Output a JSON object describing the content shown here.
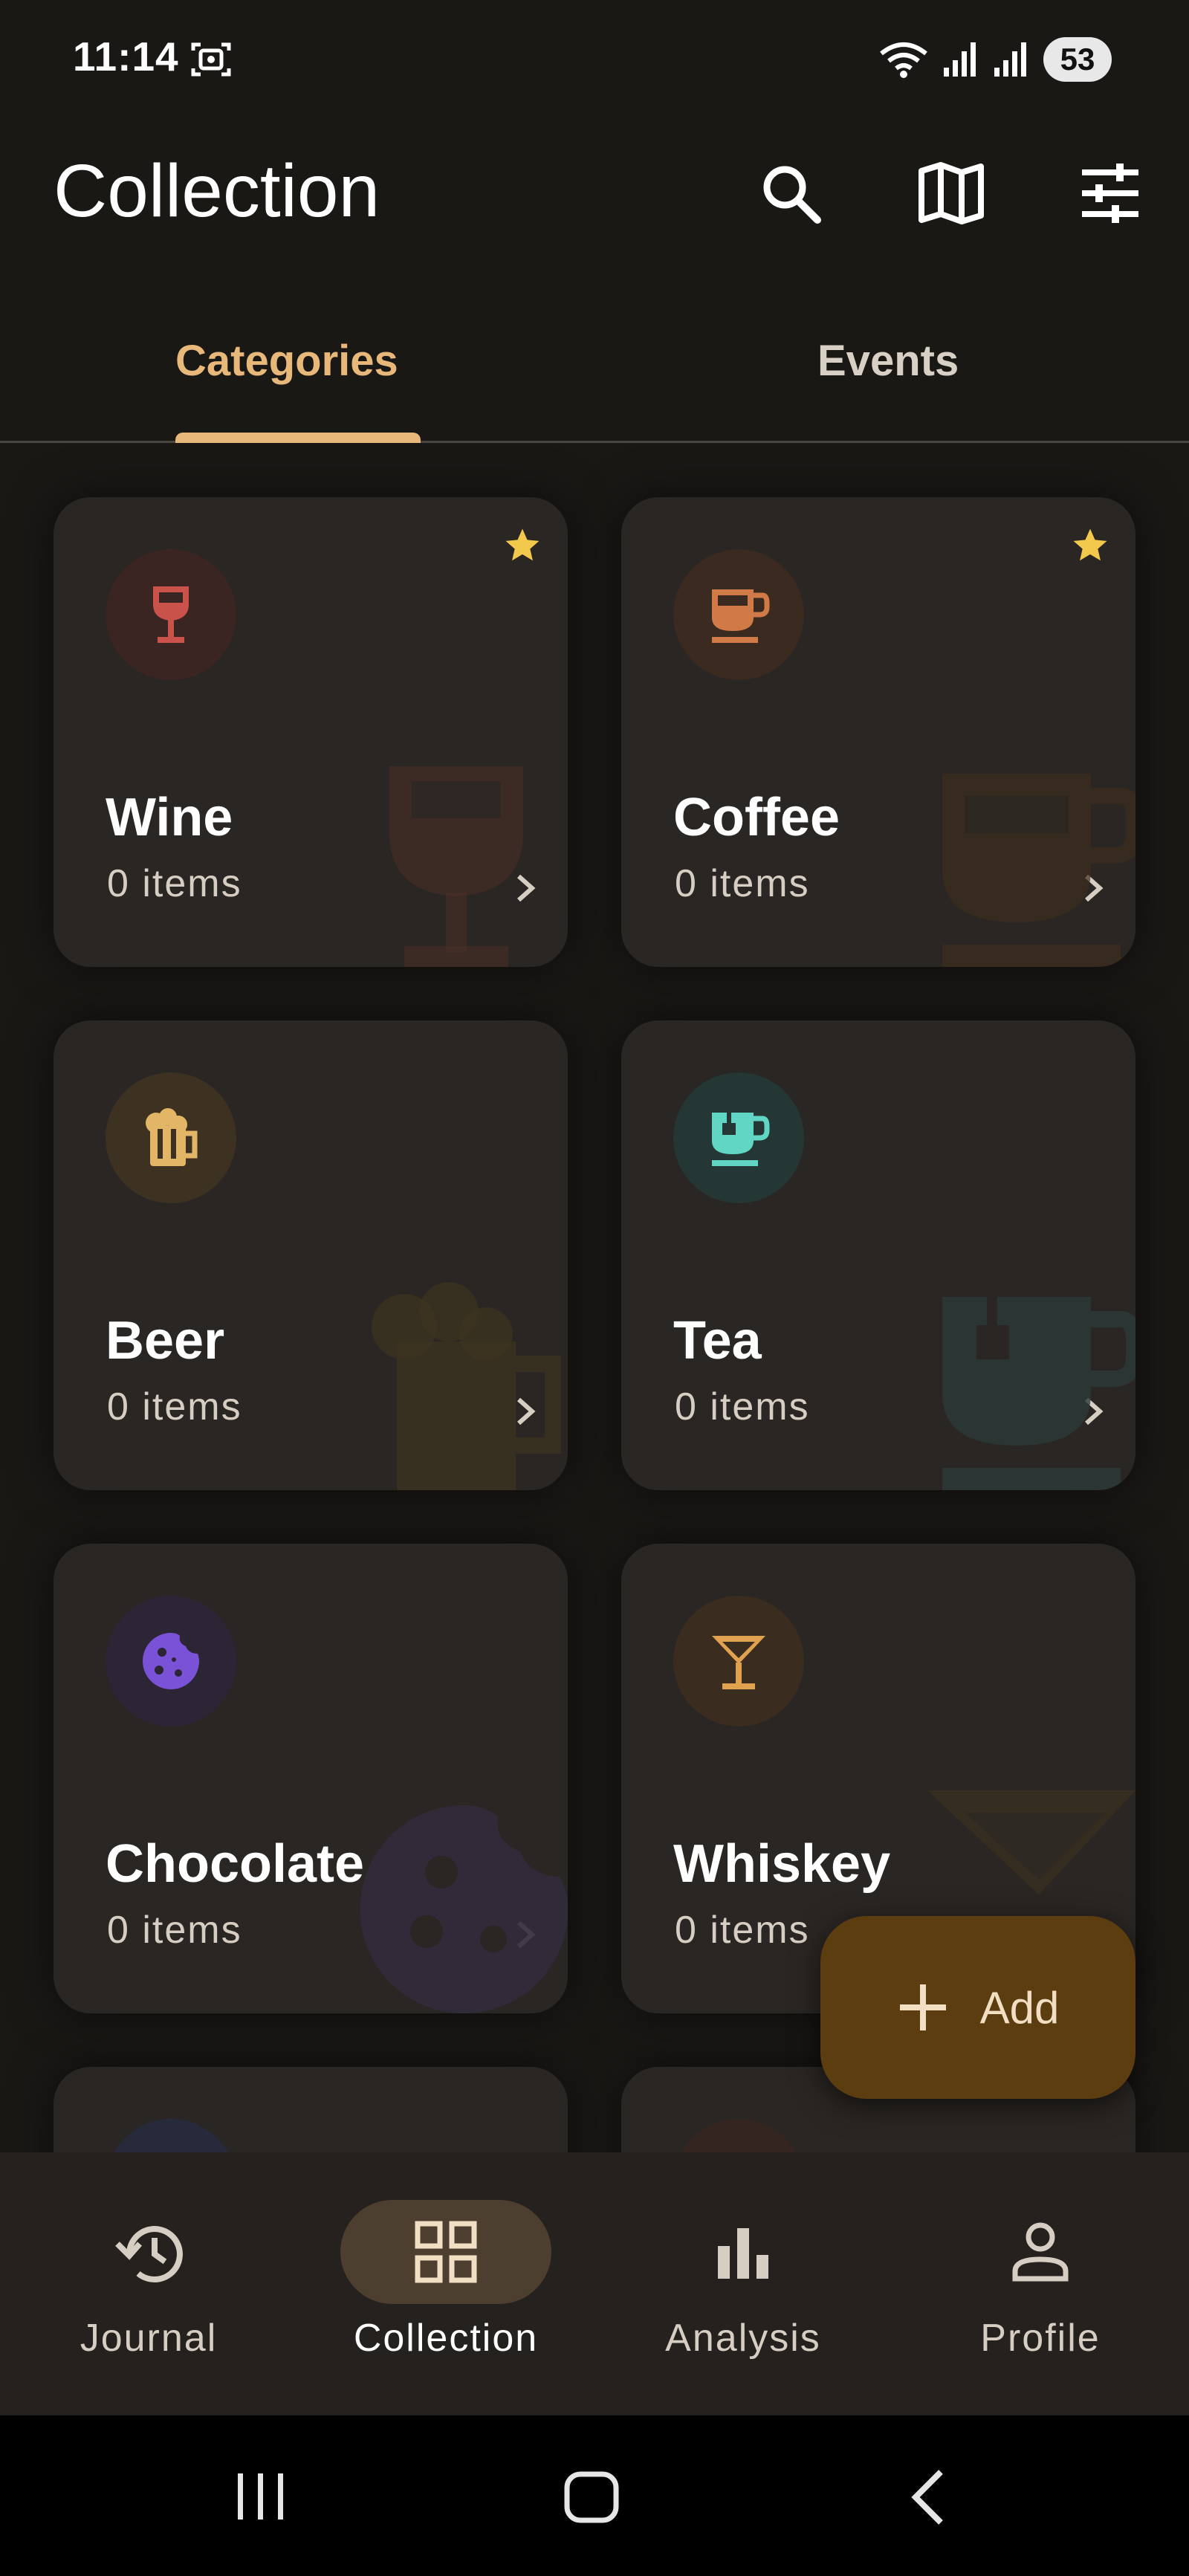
{
  "status_bar": {
    "time": "11:14",
    "battery": "53"
  },
  "header": {
    "title": "Collection"
  },
  "tabs": [
    {
      "label": "Categories",
      "active": true
    },
    {
      "label": "Events",
      "active": false
    }
  ],
  "categories": [
    {
      "name": "Wine",
      "count": "0 items",
      "favorite": true,
      "icon": "wine-glass-icon",
      "color": "#c9524a"
    },
    {
      "name": "Coffee",
      "count": "0 items",
      "favorite": true,
      "icon": "coffee-cup-icon",
      "color": "#d07a47"
    },
    {
      "name": "Beer",
      "count": "0 items",
      "favorite": false,
      "icon": "beer-mug-icon",
      "color": "#e3b667"
    },
    {
      "name": "Tea",
      "count": "0 items",
      "favorite": false,
      "icon": "tea-cup-icon",
      "color": "#62d6c4"
    },
    {
      "name": "Chocolate",
      "count": "0 items",
      "favorite": false,
      "icon": "cookie-icon",
      "color": "#7a52d8"
    },
    {
      "name": "Whiskey",
      "count": "0 items",
      "favorite": false,
      "icon": "cocktail-glass-icon",
      "color": "#e0a24f"
    }
  ],
  "fab": {
    "label": "Add"
  },
  "bottom_nav": [
    {
      "label": "Journal",
      "icon": "history-icon",
      "active": false
    },
    {
      "label": "Collection",
      "icon": "grid-icon",
      "active": true
    },
    {
      "label": "Analysis",
      "icon": "bar-chart-icon",
      "active": false
    },
    {
      "label": "Profile",
      "icon": "person-icon",
      "active": false
    }
  ],
  "colors": {
    "accent": "#e8b77a",
    "background": "#1a1815",
    "card": "#2a2623",
    "fab": "#5c3d10",
    "star": "#f2c94c"
  }
}
